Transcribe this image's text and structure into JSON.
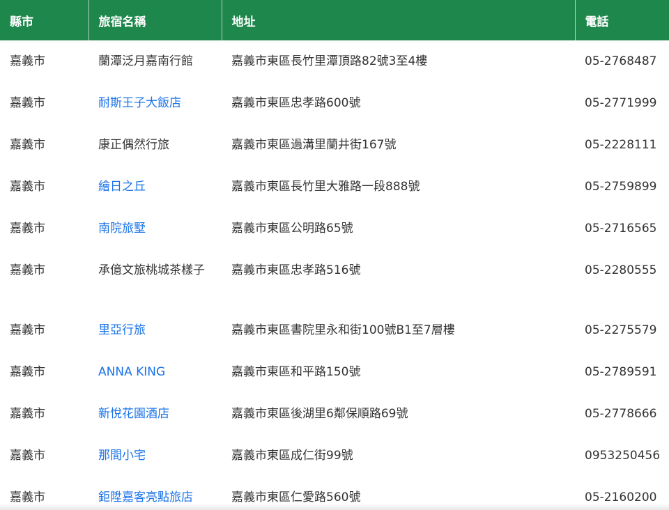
{
  "table": {
    "headers": [
      "縣市",
      "旅宿名稱",
      "地址",
      "電話"
    ],
    "rows": [
      {
        "city": "嘉義市",
        "name": "蘭潭泛月嘉南行館",
        "name_is_link": false,
        "address": "嘉義市東區長竹里潭頂路82號3至4樓",
        "phone": "05-2768487"
      },
      {
        "city": "嘉義市",
        "name": "耐斯王子大飯店",
        "name_is_link": true,
        "address": "嘉義市東區忠孝路600號",
        "phone": "05-2771999"
      },
      {
        "city": "嘉義市",
        "name": "康正偶然行旅",
        "name_is_link": false,
        "address": "嘉義市東區過溝里蘭井街167號",
        "phone": "05-2228111"
      },
      {
        "city": "嘉義市",
        "name": "繪日之丘",
        "name_is_link": true,
        "address": "嘉義市東區長竹里大雅路一段888號",
        "phone": "05-2759899"
      },
      {
        "city": "嘉義市",
        "name": "南院旅墅",
        "name_is_link": true,
        "address": "嘉義市東區公明路65號",
        "phone": "05-2716565"
      },
      {
        "city": "嘉義市",
        "name": "承億文旅桃城茶樣子",
        "name_is_link": false,
        "address": "嘉義市東區忠孝路516號",
        "phone": "05-2280555"
      },
      {
        "city": "嘉義市",
        "name": "里亞行旅",
        "name_is_link": true,
        "address": "嘉義市東區書院里永和街100號B1至7層樓",
        "phone": "05-2275579"
      },
      {
        "city": "嘉義市",
        "name": "ANNA KING",
        "name_is_link": true,
        "address": "嘉義市東區和平路150號",
        "phone": "05-2789591"
      },
      {
        "city": "嘉義市",
        "name": "新悅花園酒店",
        "name_is_link": true,
        "address": "嘉義市東區後湖里6鄰保順路69號",
        "phone": "05-2778666"
      },
      {
        "city": "嘉義市",
        "name": "那間小宅",
        "name_is_link": true,
        "address": "嘉義市東區成仁街99號",
        "phone": "0953250456"
      },
      {
        "city": "嘉義市",
        "name": "鉅陞嘉客亮點旅店",
        "name_is_link": true,
        "address": "嘉義市東區仁愛路560號",
        "phone": "05-2160200"
      }
    ]
  },
  "colors": {
    "header_bg": "#1e874b",
    "header_text": "#ffffff",
    "link": "#1a73e8",
    "text": "#333333"
  }
}
